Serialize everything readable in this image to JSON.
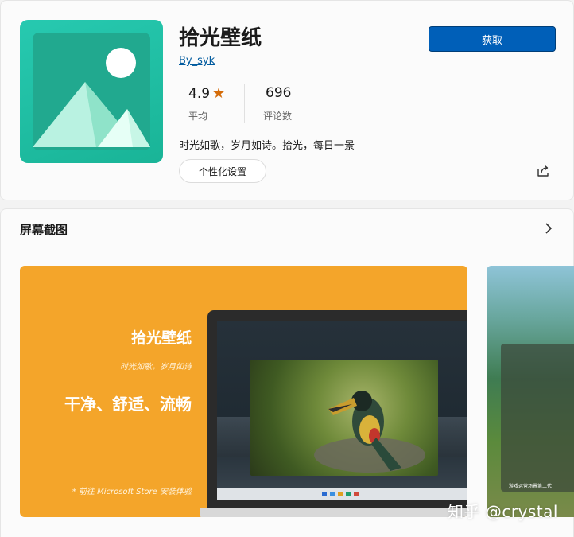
{
  "app": {
    "title": "拾光壁纸",
    "publisher": "By_syk",
    "rating": "4.9",
    "rating_label": "平均",
    "reviews": "696",
    "reviews_label": "评论数",
    "description": "时光如歌，岁月如诗。拾光，每日一景",
    "get_label": "获取",
    "personalize_label": "个性化设置",
    "icon": "mountain-sun-icon",
    "share_icon": "share-icon",
    "star_icon": "star-icon"
  },
  "screenshots": {
    "title": "屏幕截图",
    "chevron_icon": "chevron-right-icon",
    "shot1": {
      "headline": "拾光壁纸",
      "tagline": "时光如歌，岁月如诗",
      "slogan": "干净、舒适、流畅",
      "footnote": "* 前往 Microsoft Store 安装体验"
    },
    "shot2": {
      "caption": "游戏运营场景第二代"
    }
  },
  "watermark": "知乎 @crystal",
  "colors": {
    "accent": "#005fb8",
    "icon_bg": "#1fbfa2",
    "star": "#d46b08",
    "promo_bg": "#f4a52a"
  }
}
